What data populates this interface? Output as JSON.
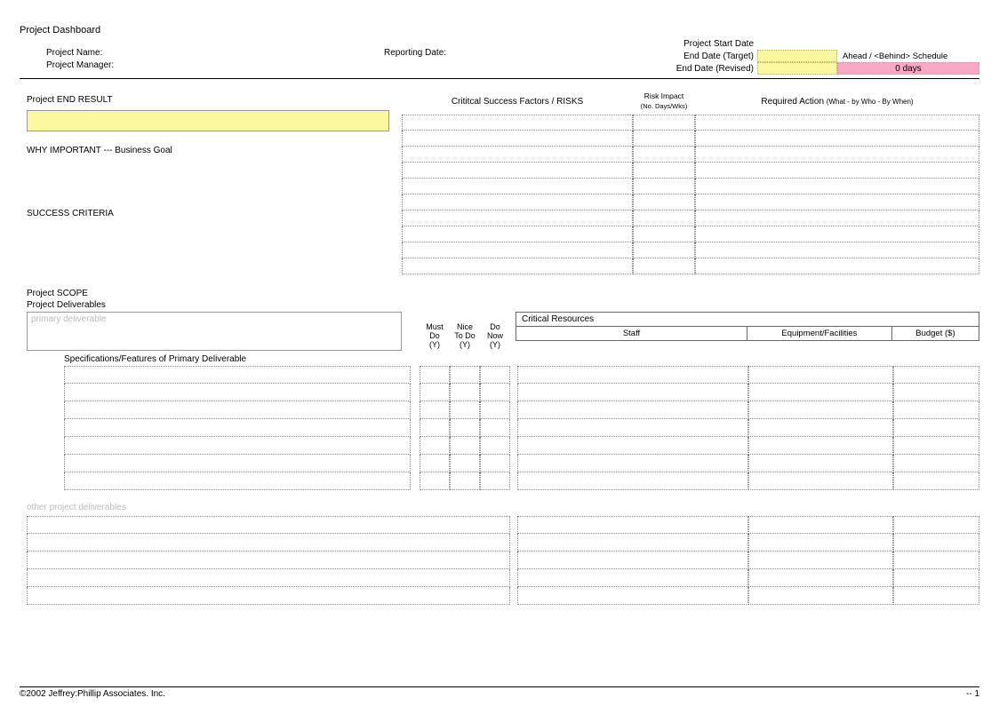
{
  "title": "Project Dashboard",
  "header": {
    "project_name_label": "Project Name:",
    "project_manager_label": "Project Manager:",
    "reporting_date_label": "Reporting Date:",
    "start_date_label": "Project Start Date",
    "end_date_target_label": "End Date (Target)",
    "end_date_revised_label": "End Date (Revised)",
    "schedule_label": "Ahead / <Behind> Schedule",
    "schedule_value": "0 days"
  },
  "section1": {
    "end_result": "Project END RESULT",
    "why_important": "WHY IMPORTANT --- Business Goal",
    "success_criteria": "SUCCESS CRITERIA",
    "csf_header": "Crititcal Success Factors / RISKS",
    "risk_impact_header": "Risk Impact",
    "risk_impact_sub": "(No. Days/Wks)",
    "required_action_header": "Required Action",
    "required_action_sub": "(What - by Who - By When)"
  },
  "section2": {
    "scope": "Project SCOPE",
    "deliverables": "Project Deliverables",
    "primary_placeholder": "primary deliverable",
    "spec_label": "Specifications/Features of Primary Deliverable",
    "must_do": [
      "Must",
      "Do",
      "(Y)"
    ],
    "nice_to_do": [
      "Nice",
      "To Do",
      "(Y)"
    ],
    "do_now": [
      "Do",
      "Now",
      "(Y)"
    ],
    "critical_resources": "Critical Resources",
    "staff": "Staff",
    "equipment": "Equipment/Facilities",
    "budget": "Budget ($)",
    "other_deliverables": "other project deliverables"
  },
  "footer": {
    "copyright": "©2002 Jeffrey:Phillip Associates. Inc.",
    "page": "-- 1"
  }
}
